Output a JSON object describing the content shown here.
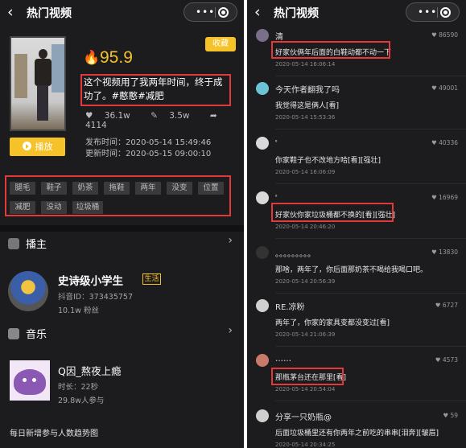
{
  "left": {
    "header": {
      "back_glyph": "‹",
      "title": "热门视频"
    },
    "video": {
      "score": "95.9",
      "collect_label": "收藏",
      "description": "这个视频用了我两年时间，终于成功了。#憨憨#减肥",
      "stats": {
        "likes": "36.1w",
        "comments": "3.5w",
        "shares": "4114"
      },
      "play_label": "播放",
      "published": "发布时间：2020-05-14 15:49:46",
      "updated": "更新时间：2020-05-15 09:00:10",
      "tags": [
        "腿毛",
        "鞋子",
        "奶茶",
        "拖鞋",
        "两年",
        "没变",
        "位置",
        "减肥",
        "没动",
        "垃圾桶"
      ]
    },
    "streamer_section": {
      "title": "播主",
      "name": "史诗级小学生",
      "badge": "生活",
      "douyin_id": "抖音ID：373435757",
      "fans": "10.1w 粉丝"
    },
    "music_section": {
      "title": "音乐",
      "name": "Q因_熬夜上瘾",
      "duration": "时长：22秒",
      "users": "29.8w人参与"
    },
    "daily_title": "每日新增参与人数趋势图"
  },
  "right": {
    "header": {
      "back_glyph": "‹",
      "title": "热门视频"
    },
    "comments": [
      {
        "name": "清",
        "likes": "86590",
        "text": "好家伙俩年后面的白鞋动都不动一下",
        "date": "2020-05-14 16:06:14",
        "avatar_color": "#7a6e8a"
      },
      {
        "name": "今天作者翻我了吗",
        "likes": "49001",
        "text": "我觉得这是俩人[看]",
        "date": "2020-05-14 15:53:36",
        "avatar_color": "#6cc3d6"
      },
      {
        "name": "ﾟ",
        "likes": "40336",
        "text": "你家鞋子也不改地方哈[看][强壮]",
        "date": "2020-05-14 16:06:09",
        "avatar_color": "#d9d9d9"
      },
      {
        "name": "ﾟ",
        "likes": "16969",
        "text": "好家伙你家垃圾桶都不换的[看][强壮]",
        "date": "2020-05-14 20:46:20",
        "avatar_color": "#d9d9d9"
      },
      {
        "name": "。。。。。。。。。",
        "likes": "13830",
        "text": "那啥，两年了，你后面那奶茶不喝给我喝口吧。",
        "date": "2020-05-14 20:56:39",
        "avatar_color": "#333333"
      },
      {
        "name": "RE.凉粉",
        "likes": "6727",
        "text": "两年了，你家的家具变都没变过[看]",
        "date": "2020-05-14 21:06:39",
        "avatar_color": "#d0d0d0"
      },
      {
        "name": "……",
        "likes": "4573",
        "text": "那瓶茅台还在那里[看]",
        "date": "2020-05-14 20:54:04",
        "avatar_color": "#c97a6a"
      },
      {
        "name": "分享一只奶瓶@",
        "likes": "59",
        "text": "后面垃圾桶里还有你两年之前吃的串串[泪奔][皱眉]",
        "date": "2020-05-14 20:34:25",
        "avatar_color": "#cfcfcf"
      }
    ]
  },
  "colors": {
    "accent": "#f6c229",
    "highlight_box": "#e23a3a",
    "panel_bg": "#1c1c1e"
  }
}
